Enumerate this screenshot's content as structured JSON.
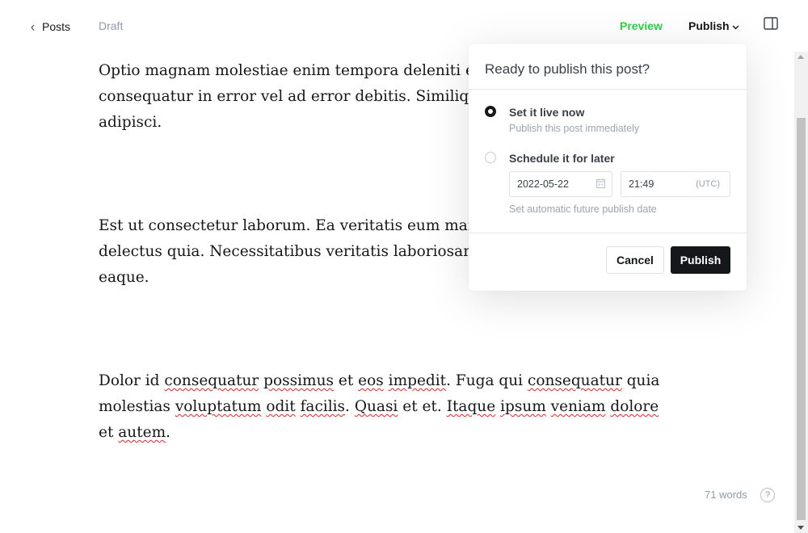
{
  "header": {
    "back_label": "Posts",
    "status": "Draft",
    "preview_label": "Preview",
    "publish_label": "Publish"
  },
  "editor": {
    "paragraphs": [
      "Optio magnam molestiae enim tempora deleniti et iusto. Sequi vero commodi rerum consequatur in error vel ad error debitis. Similique ea dignissimos hic eius aut adipisci.",
      "Est ut consectetur laborum. Ea veritatis eum maiores. Ut ut ea cumque voluptates delectus quia. Necessitatibus veritatis laboriosam vel nemo repellendus suscipit eaque.",
      "Dolor id consequatur possimus et eos impedit. Fuga qui consequatur quia molestias voluptatum odit facilis. Quasi et et. Itaque ipsum veniam dolore et autem."
    ],
    "p1_line1": "Optio magnam molestiae enim tempora deleniti et i",
    "p1_line2": "consequatur in error vel ad error debitis. Similique",
    "p1_line3": "adipisci.",
    "p2_line1": "Est ut consectetur laborum. Ea veritatis eum maiore",
    "p2_line2": "delectus quia. Necessitatibus veritatis laboriosam vo",
    "p2_line3": "eaque."
  },
  "publish_popover": {
    "title": "Ready to publish this post?",
    "option_now": {
      "label": "Set it live now",
      "description": "Publish this post immediately",
      "selected": true
    },
    "option_schedule": {
      "label": "Schedule it for later",
      "date": "2022-05-22",
      "time": "21:49",
      "timezone": "(UTC)",
      "description": "Set automatic future publish date",
      "selected": false
    },
    "cancel_label": "Cancel",
    "publish_label": "Publish"
  },
  "footer": {
    "word_count": "71 words",
    "help_symbol": "?"
  },
  "colors": {
    "accent_green": "#30cf43",
    "primary_dark": "#15171a",
    "muted_text": "#8e9cac",
    "spellcheck_red": "#e02424"
  },
  "icons": [
    "chevron-left-icon",
    "chevron-down-icon",
    "sidebar-toggle-icon",
    "calendar-icon",
    "help-icon"
  ]
}
